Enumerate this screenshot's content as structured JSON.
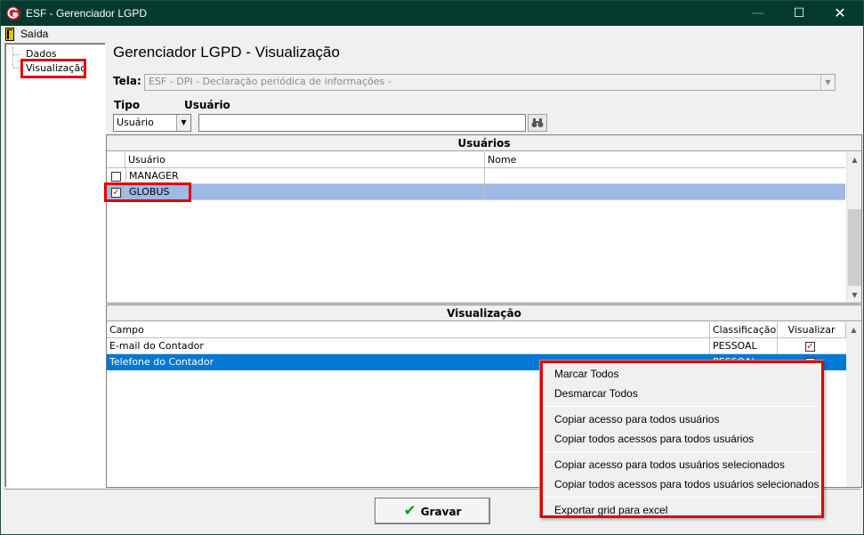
{
  "window": {
    "title": "ESF - Gerenciador LGPD",
    "minimize": "—",
    "maximize": "☐",
    "close": "✕"
  },
  "menu": {
    "exit": "Saída"
  },
  "tree": {
    "items": [
      "Dados",
      "Visualização"
    ]
  },
  "header": {
    "title": "Gerenciador LGPD - Visualização",
    "tela_label": "Tela:",
    "tela_value": "ESF - DPI - Declaração periódica de informações -",
    "tipo_label": "Tipo",
    "usuario_label": "Usuário",
    "tipo_value": "Usuário",
    "usuario_value": ""
  },
  "usuarios": {
    "title": "Usuários",
    "columns": [
      "Usuário",
      "Nome"
    ],
    "rows": [
      {
        "usuario": "MANAGER",
        "nome": "",
        "checked": false
      },
      {
        "usuario": "GLOBUS",
        "nome": "",
        "checked": true
      }
    ]
  },
  "visualizacao": {
    "title": "Visualização",
    "columns": [
      "Campo",
      "Classificação",
      "Visualizar"
    ],
    "rows": [
      {
        "campo": "E-mail do Contador",
        "classificacao": "PESSOAL",
        "visualizar": true
      },
      {
        "campo": "Telefone do Contador",
        "classificacao": "PESSOAL",
        "visualizar": true
      }
    ]
  },
  "context_menu": {
    "items": [
      "Marcar Todos",
      "Desmarcar Todos",
      "Copiar acesso para todos usuários",
      "Copiar todos acessos para todos usuários",
      "Copiar acesso para todos usuários selecionados",
      "Copiar todos acessos para todos usuários selecionados",
      "Exportar grid para excel"
    ]
  },
  "footer": {
    "save_label": "Gravar"
  },
  "colors": {
    "titlebar": "#033a2d",
    "highlight": "#e00000",
    "selected_row": "#9fb8e7",
    "selected_row_blue": "#0078d7"
  }
}
